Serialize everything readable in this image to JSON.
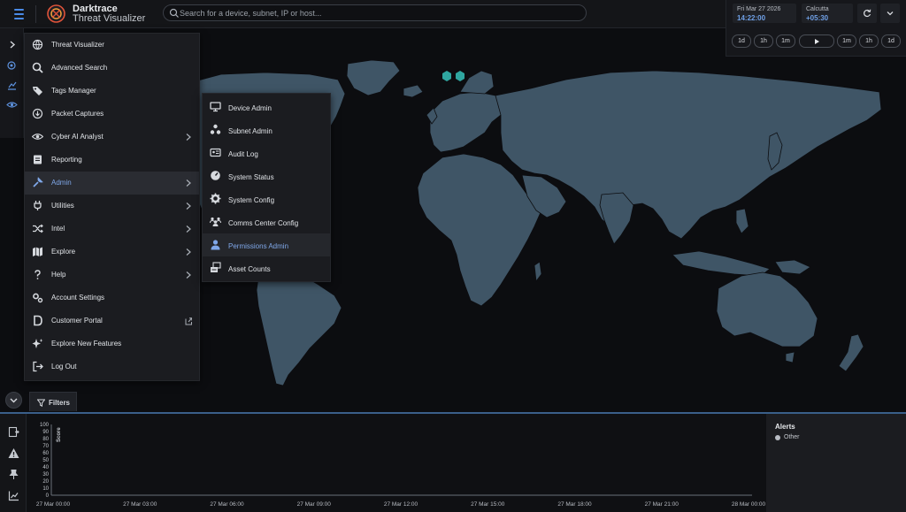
{
  "header": {
    "brand_line1": "Darktrace",
    "brand_line2": "Threat Visualizer",
    "search_placeholder": "Search for a device, subnet, IP or host...",
    "date_label": "Fri Mar 27 2026",
    "time_value": "14:22:00",
    "timezone_label": "Calcutta",
    "timezone_offset": "+05:30",
    "time_controls": [
      "1d",
      "1h",
      "1m",
      "play",
      "1m",
      "1h",
      "1d"
    ]
  },
  "main_menu": {
    "items": [
      {
        "label": "Threat Visualizer",
        "icon": "globe-icon"
      },
      {
        "label": "Advanced Search",
        "icon": "search-icon"
      },
      {
        "label": "Tags Manager",
        "icon": "tag-icon"
      },
      {
        "label": "Packet Captures",
        "icon": "download-circle-icon"
      },
      {
        "label": "Cyber AI Analyst",
        "icon": "eye-icon"
      },
      {
        "label": "Reporting",
        "icon": "report-icon"
      },
      {
        "label": "Admin",
        "icon": "wrench-icon"
      },
      {
        "label": "Utilities",
        "icon": "plug-icon"
      },
      {
        "label": "Intel",
        "icon": "shuffle-icon"
      },
      {
        "label": "Explore",
        "icon": "map-icon"
      },
      {
        "label": "Help",
        "icon": "question-icon"
      },
      {
        "label": "Account Settings",
        "icon": "gears-icon"
      },
      {
        "label": "Customer Portal",
        "icon": "portal-icon"
      },
      {
        "label": "Explore New Features",
        "icon": "sparkle-icon"
      },
      {
        "label": "Log Out",
        "icon": "logout-icon"
      }
    ],
    "active_item": "Admin"
  },
  "admin_submenu": {
    "items": [
      {
        "label": "Device Admin",
        "icon": "monitor-icon"
      },
      {
        "label": "Subnet Admin",
        "icon": "network-icon"
      },
      {
        "label": "Audit Log",
        "icon": "id-card-icon"
      },
      {
        "label": "System Status",
        "icon": "gauge-icon"
      },
      {
        "label": "System Config",
        "icon": "gear-icon"
      },
      {
        "label": "Comms Center Config",
        "icon": "users-icon"
      },
      {
        "label": "Permissions Admin",
        "icon": "user-icon"
      },
      {
        "label": "Asset Counts",
        "icon": "asset-icon"
      }
    ],
    "active_item": "Permissions Admin"
  },
  "bottom_panel": {
    "filters_label": "Filters",
    "alerts_title": "Alerts",
    "alerts_legend": "Other",
    "score_label": "Score"
  },
  "chart_data": {
    "type": "bar",
    "ylabel": "Score",
    "ylim": [
      0,
      100
    ],
    "y_ticks": [
      "100",
      "90",
      "80",
      "70",
      "60",
      "50",
      "40",
      "30",
      "20",
      "10",
      "0"
    ],
    "x_ticks": [
      "27 Mar 00:00",
      "27 Mar 03:00",
      "27 Mar 06:00",
      "27 Mar 09:00",
      "27 Mar 12:00",
      "27 Mar 15:00",
      "27 Mar 18:00",
      "27 Mar 21:00",
      "28 Mar 00:00"
    ],
    "series": [
      {
        "name": "Other",
        "values": []
      }
    ]
  },
  "colors": {
    "accent": "#4a8be8",
    "land": "#3f5566",
    "marker": "#2fa6a0"
  }
}
